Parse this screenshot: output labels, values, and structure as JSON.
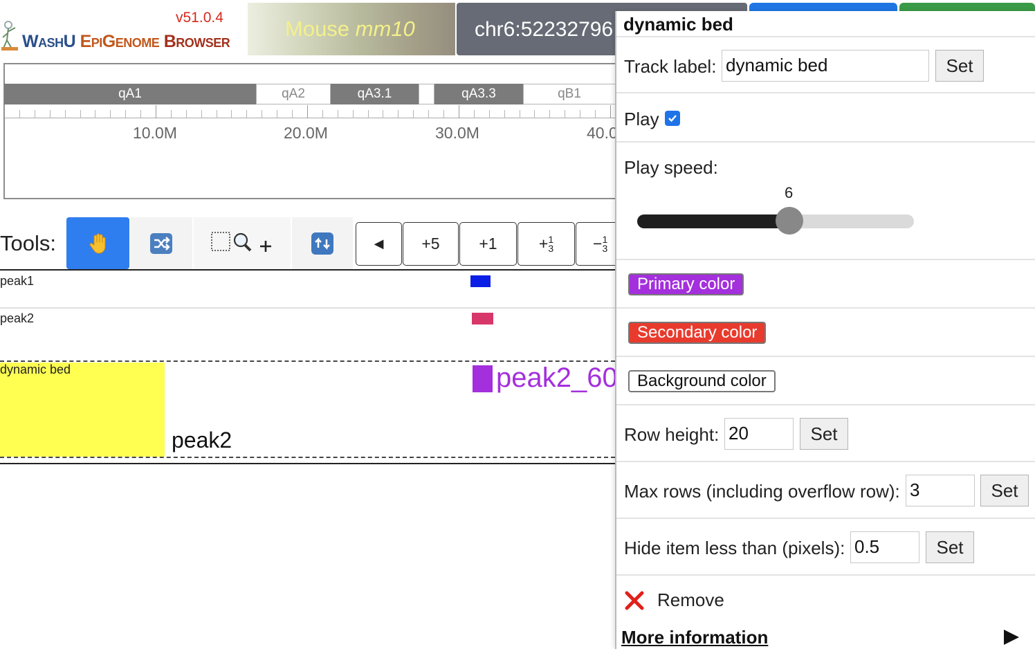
{
  "header": {
    "version": "v51.0.4",
    "logo_text": {
      "part1": "WashU ",
      "part2": "EpiGenome ",
      "part3": "Browser"
    },
    "genome": {
      "species": "Mouse",
      "assembly": "mm10"
    },
    "coordinates": "chr6:52232796"
  },
  "ideogram": {
    "bands": [
      {
        "name": "qA1",
        "shade": "dark"
      },
      {
        "name": "qA2",
        "shade": "light"
      },
      {
        "name": "qA3.1",
        "shade": "dark"
      },
      {
        "name": "",
        "shade": "light"
      },
      {
        "name": "qA3.3",
        "shade": "dark"
      },
      {
        "name": "qB1",
        "shade": "light"
      }
    ],
    "ruler_labels": [
      "10.0M",
      "20.0M",
      "30.0M",
      "40.0"
    ]
  },
  "tools": {
    "label": "Tools:",
    "nav_buttons": [
      "◀",
      "+5",
      "+1",
      "+",
      "−"
    ],
    "fraction": {
      "num": "1",
      "den": "3"
    }
  },
  "tracks": [
    {
      "label": "peak1",
      "color": "#0b1ee6"
    },
    {
      "label": "peak2",
      "color": "#d8376a"
    }
  ],
  "dynamic_track": {
    "label": "dynamic bed",
    "big_label": "peak2_60",
    "item_label": "peak2",
    "primary_color": "#a42fdc",
    "background_color": "#ffff52"
  },
  "panel": {
    "title": "dynamic bed",
    "track_label": {
      "label": "Track label:",
      "value": "dynamic bed",
      "set": "Set"
    },
    "play": {
      "label": "Play",
      "checked": true
    },
    "play_speed": {
      "label": "Play speed:",
      "value": 6,
      "min": 1,
      "max": 10
    },
    "primary_color": {
      "label": "Primary color",
      "color": "#a42fdc"
    },
    "secondary_color": {
      "label": "Secondary color",
      "color": "#e83b2e"
    },
    "background_color": {
      "label": "Background color",
      "color": "#ffffff"
    },
    "row_height": {
      "label": "Row height:",
      "value": "20",
      "set": "Set"
    },
    "max_rows": {
      "label": "Max rows (including overflow row):",
      "value": "3",
      "set": "Set"
    },
    "hide_item": {
      "label": "Hide item less than (pixels):",
      "value": "0.5",
      "set": "Set"
    },
    "remove": "Remove",
    "more_info": "More information"
  }
}
